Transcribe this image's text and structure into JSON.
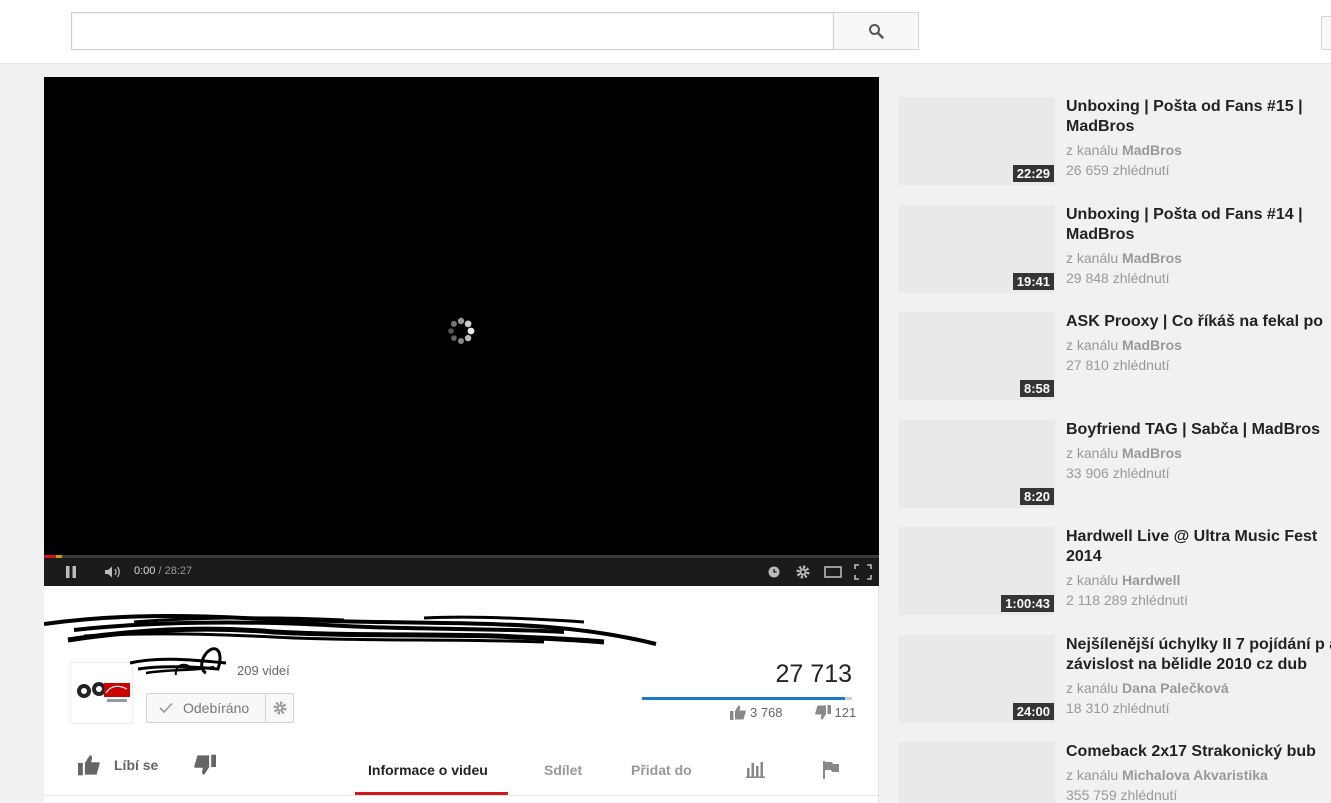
{
  "player": {
    "current_time": "0:00",
    "separator": " / ",
    "duration": "28:27",
    "played_fraction": 0.0
  },
  "channel": {
    "video_count": "209 videí",
    "subscribe_label": "Odebíráno"
  },
  "stats": {
    "view_count": "27 713",
    "likes": "3 768",
    "dislikes": "121",
    "like_fraction": 0.969
  },
  "actions": {
    "like_label": "Líbí se"
  },
  "tabs": [
    {
      "label": "Informace o videu",
      "active": true
    },
    {
      "label": "Sdílet",
      "active": false
    },
    {
      "label": "Přidat do",
      "active": false
    }
  ],
  "related": {
    "channel_prefix": "z kanálu ",
    "items": [
      {
        "title": "Unboxing | Pošta od Fans #15 | MadBros",
        "channel": "MadBros",
        "views": "26 659 zhlédnutí",
        "duration": "22:29"
      },
      {
        "title": "Unboxing | Pošta od Fans #14 | MadBros",
        "channel": "MadBros",
        "views": "29 848 zhlédnutí",
        "duration": "19:41"
      },
      {
        "title": "ASK Prooxy | Co říkáš na fekal po",
        "channel": "MadBros",
        "views": "27 810 zhlédnutí",
        "duration": "8:58"
      },
      {
        "title": "Boyfriend TAG | Sabča | MadBros",
        "channel": "MadBros",
        "views": "33 906 zhlédnutí",
        "duration": "8:20"
      },
      {
        "title": "Hardwell Live @ Ultra Music Fest 2014",
        "channel": "Hardwell",
        "views": "2 118 289 zhlédnutí",
        "duration": "1:00:43"
      },
      {
        "title": "Nejšílenější úchylky II 7 pojídání p a závislost na bělidle 2010 cz dub",
        "channel": "Dana Palečková",
        "views": "18 310 zhlédnutí",
        "duration": "24:00"
      },
      {
        "title": "Comeback 2x17 Strakonický bub",
        "channel": "Michalova Akvaristika",
        "views": "355 759 zhlédnutí",
        "duration": ""
      }
    ]
  },
  "colors": {
    "accent_red": "#cc181e",
    "like_blue": "#167ac6"
  }
}
